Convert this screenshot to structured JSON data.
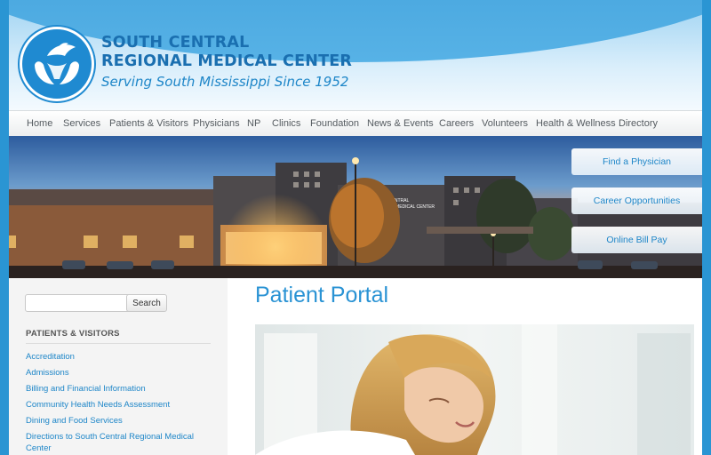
{
  "brand": {
    "name_line1": "SOUTH CENTRAL",
    "name_line2": "REGIONAL MEDICAL CENTER",
    "tagline": "Serving South Mississippi Since 1952",
    "logo_icon": "dove-hands-icon",
    "primary_color": "#1a6fb0",
    "accent_color": "#2a95d3"
  },
  "nav": {
    "items": [
      {
        "label": "Home"
      },
      {
        "label": "Services"
      },
      {
        "label": "Patients & Visitors"
      },
      {
        "label": "Physicians"
      },
      {
        "label": "NP"
      },
      {
        "label": "Clinics"
      },
      {
        "label": "Foundation"
      },
      {
        "label": "News & Events"
      },
      {
        "label": "Careers"
      },
      {
        "label": "Volunteers"
      },
      {
        "label": "Health & Wellness"
      },
      {
        "label": "Directory"
      }
    ]
  },
  "hero": {
    "building_sign": "SOUTH CENTRAL REGIONAL MEDICAL CENTER",
    "ctas": [
      {
        "label": "Find a Physician"
      },
      {
        "label": "Career Opportunities"
      },
      {
        "label": "Online Bill Pay"
      }
    ]
  },
  "sidebar": {
    "search": {
      "value": "",
      "placeholder": "",
      "button_label": "Search"
    },
    "heading": "PATIENTS & VISITORS",
    "links": [
      {
        "label": "Accreditation"
      },
      {
        "label": "Admissions"
      },
      {
        "label": "Billing and Financial Information"
      },
      {
        "label": "Community Health Needs Assessment"
      },
      {
        "label": "Dining and Food Services"
      },
      {
        "label": "Directions to South Central Regional Medical Center"
      }
    ]
  },
  "main": {
    "title": "Patient Portal"
  }
}
